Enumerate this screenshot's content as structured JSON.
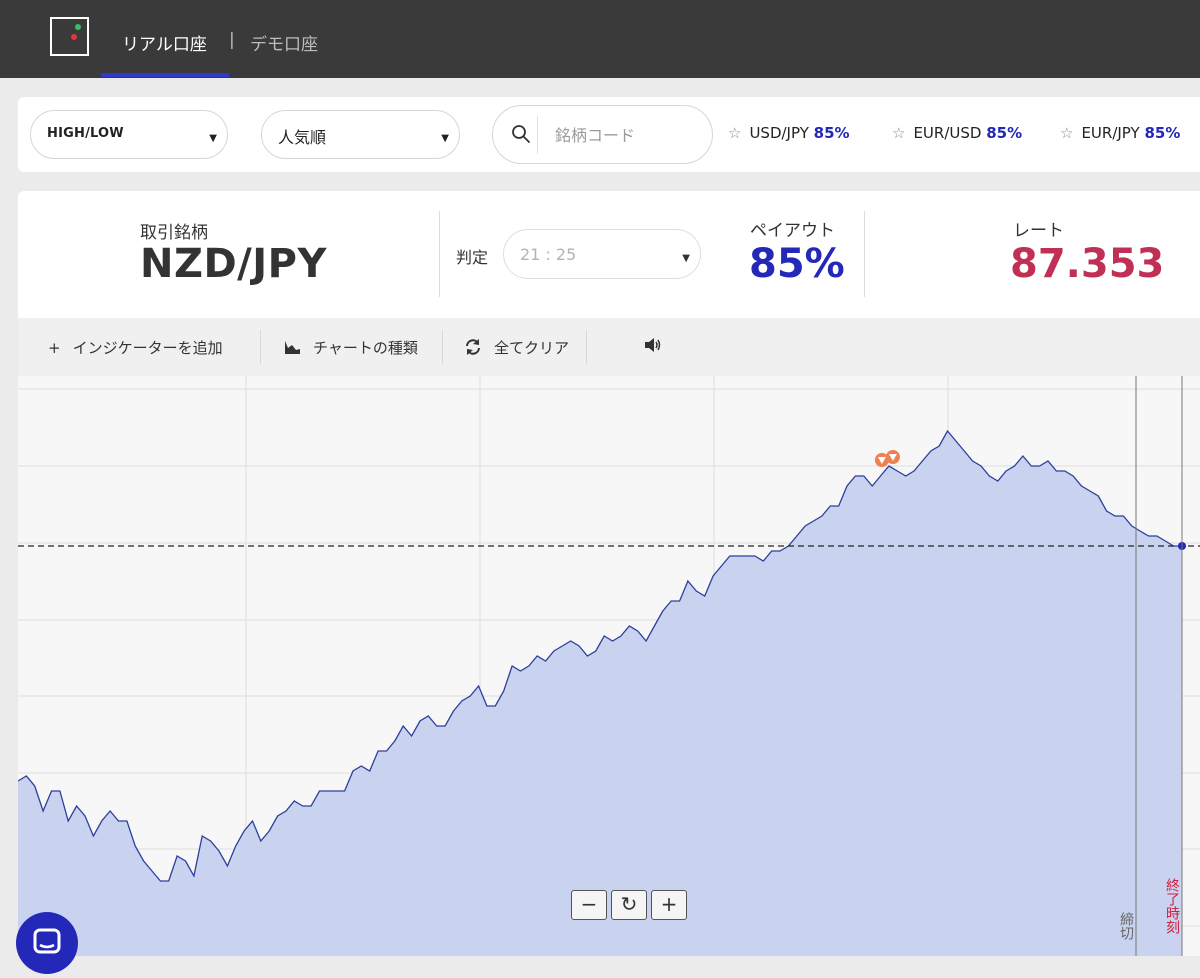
{
  "header": {
    "tabs": [
      {
        "label": "リアル口座",
        "active": true
      },
      {
        "label": "デモ口座",
        "active": false
      }
    ],
    "separator": "|"
  },
  "filters": {
    "trade_type": "HIGH/LOW",
    "sort": "人気順",
    "search_placeholder": "銘柄コード",
    "favorites": [
      {
        "pair": "USD/JPY",
        "payout": "85%"
      },
      {
        "pair": "EUR/USD",
        "payout": "85%"
      },
      {
        "pair": "EUR/JPY",
        "payout": "85%"
      }
    ]
  },
  "info": {
    "symbol_label": "取引銘柄",
    "symbol": "NZD/JPY",
    "judge_label": "判定",
    "judge_time": "21 : 25",
    "payout_label": "ペイアウト",
    "payout": "85%",
    "rate_label": "レート",
    "rate": "87.353"
  },
  "toolbar": {
    "add_indicator": "インジケーターを追加",
    "chart_type": "チャートの種類",
    "clear_all": "全てクリア"
  },
  "chart_labels": {
    "cutoff": "締切",
    "end_time": "終了時刻"
  },
  "zoom": {
    "minus": "−",
    "reset": "↻",
    "plus": "+"
  },
  "colors": {
    "accent_blue": "#2328b8",
    "rate_red": "#c03054",
    "chart_fill": "#c9d3ef",
    "chart_line": "#2e3f9c",
    "marker_orange": "#f08050"
  },
  "chart_data": {
    "type": "area",
    "current_rate": 87.353,
    "values": [
      0.27,
      0.28,
      0.26,
      0.21,
      0.25,
      0.25,
      0.19,
      0.22,
      0.2,
      0.16,
      0.19,
      0.21,
      0.19,
      0.19,
      0.14,
      0.11,
      0.09,
      0.07,
      0.07,
      0.12,
      0.11,
      0.08,
      0.16,
      0.15,
      0.13,
      0.1,
      0.14,
      0.17,
      0.19,
      0.15,
      0.17,
      0.2,
      0.21,
      0.23,
      0.22,
      0.22,
      0.25,
      0.25,
      0.25,
      0.25,
      0.29,
      0.3,
      0.29,
      0.33,
      0.33,
      0.35,
      0.38,
      0.36,
      0.39,
      0.4,
      0.38,
      0.38,
      0.41,
      0.43,
      0.44,
      0.46,
      0.42,
      0.42,
      0.45,
      0.5,
      0.49,
      0.5,
      0.52,
      0.51,
      0.53,
      0.54,
      0.55,
      0.54,
      0.52,
      0.53,
      0.56,
      0.55,
      0.56,
      0.58,
      0.57,
      0.55,
      0.58,
      0.61,
      0.63,
      0.63,
      0.67,
      0.65,
      0.64,
      0.68,
      0.7,
      0.72,
      0.72,
      0.72,
      0.72,
      0.71,
      0.73,
      0.73,
      0.74,
      0.76,
      0.78,
      0.79,
      0.8,
      0.82,
      0.82,
      0.86,
      0.88,
      0.88,
      0.86,
      0.88,
      0.9,
      0.89,
      0.88,
      0.89,
      0.91,
      0.93,
      0.94,
      0.97,
      0.95,
      0.93,
      0.91,
      0.9,
      0.88,
      0.87,
      0.89,
      0.9,
      0.92,
      0.9,
      0.9,
      0.91,
      0.89,
      0.89,
      0.88,
      0.86,
      0.85,
      0.84,
      0.81,
      0.8,
      0.8,
      0.78,
      0.77,
      0.76,
      0.76,
      0.75,
      0.74,
      0.74
    ],
    "ylim": [
      0,
      1
    ],
    "grid": true,
    "high_low_markers": 2
  }
}
